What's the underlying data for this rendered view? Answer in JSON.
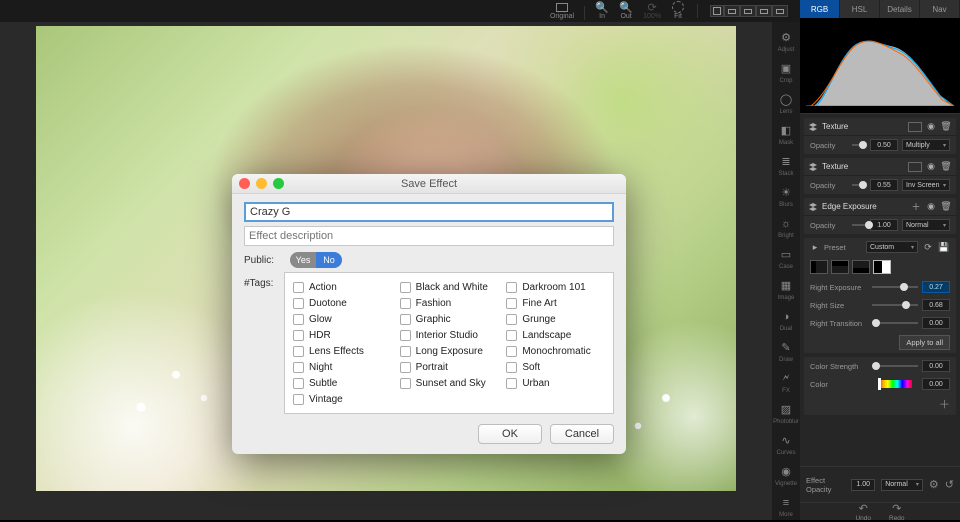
{
  "toolbar": {
    "items": [
      {
        "label": "Original",
        "icon": "image-icon"
      },
      {
        "label": "In",
        "icon": "zoom-in-icon"
      },
      {
        "label": "Out",
        "icon": "zoom-out-icon"
      },
      {
        "label": "100%",
        "icon": "refresh-icon"
      },
      {
        "label": "Fit",
        "icon": "fit-icon"
      }
    ]
  },
  "viewer_modes": 4,
  "vtools": [
    {
      "name": "adjust-tool",
      "label": "Adjust",
      "glyph": "⚙"
    },
    {
      "name": "crop-tool",
      "label": "Crop",
      "glyph": "▣"
    },
    {
      "name": "lens-tool",
      "label": "Lens",
      "glyph": "◯"
    },
    {
      "name": "mask-tool",
      "label": "Mask",
      "glyph": "◧"
    },
    {
      "name": "stack-tool",
      "label": "Stack",
      "glyph": "≣"
    },
    {
      "name": "blurs-tool",
      "label": "Blurs",
      "glyph": "☀"
    },
    {
      "name": "highlight-tool",
      "label": "Bright",
      "glyph": "☼"
    },
    {
      "name": "layer-tool",
      "label": "Case",
      "glyph": "▭"
    },
    {
      "name": "image-tool",
      "label": "Image",
      "glyph": "▦"
    },
    {
      "name": "dual-tool",
      "label": "Dual",
      "glyph": "◑"
    },
    {
      "name": "draw-tool",
      "label": "Draw",
      "glyph": "✎"
    },
    {
      "name": "fx-tool",
      "label": "FX",
      "glyph": "🗲"
    },
    {
      "name": "photogrid-tool",
      "label": "Photoblur",
      "glyph": "▨"
    },
    {
      "name": "curves-tool",
      "label": "Curves",
      "glyph": "∿"
    },
    {
      "name": "vignette-tool",
      "label": "Vignette",
      "glyph": "◉"
    },
    {
      "name": "more-tool",
      "label": "More",
      "glyph": "≡"
    }
  ],
  "tabs": {
    "items": [
      "RGB",
      "HSL",
      "Details",
      "Nav"
    ],
    "active": 0
  },
  "sections": {
    "texture1": {
      "title": "Texture",
      "opacity_label": "Opacity",
      "opacity": "0.50",
      "blend": "Multiply"
    },
    "texture2": {
      "title": "Texture",
      "opacity_label": "Opacity",
      "opacity": "0.55",
      "blend": "Inv Screen"
    },
    "edge": {
      "title": "Edge Exposure",
      "opacity_label": "Opacity",
      "opacity": "1.00",
      "blend": "Normal",
      "preset_label": "Preset",
      "preset": "Custom",
      "right_exposure_label": "Right Exposure",
      "right_exposure": "0.27",
      "right_size_label": "Right Size",
      "right_size": "0.68",
      "right_transition_label": "Right Transition",
      "right_transition": "0.00",
      "apply_all": "Apply to all"
    },
    "color": {
      "strength_label": "Color Strength",
      "strength": "0.00",
      "color_label": "Color",
      "color": "0.00"
    }
  },
  "footer": {
    "effect_opacity_label": "Effect Opacity",
    "effect_opacity": "1.00",
    "blend": "Normal",
    "undo": "Undo",
    "redo": "Redo",
    "cog": "Cog",
    "reset": "Reset"
  },
  "modal": {
    "title": "Save Effect",
    "name_value": "Crazy G",
    "desc_placeholder": "Effect description",
    "public_label": "Public:",
    "toggle_yes": "Yes",
    "toggle_no": "No",
    "tags_label": "#Tags:",
    "tags": [
      "Action",
      "Black and White",
      "Darkroom 101",
      "Duotone",
      "Fashion",
      "Fine Art",
      "Glow",
      "Graphic",
      "Grunge",
      "HDR",
      "Interior Studio",
      "Landscape",
      "Lens Effects",
      "Long Exposure",
      "Monochromatic",
      "Night",
      "Portrait",
      "Soft",
      "Subtle",
      "Sunset and Sky",
      "Urban",
      "Vintage",
      "",
      ""
    ],
    "ok": "OK",
    "cancel": "Cancel"
  }
}
